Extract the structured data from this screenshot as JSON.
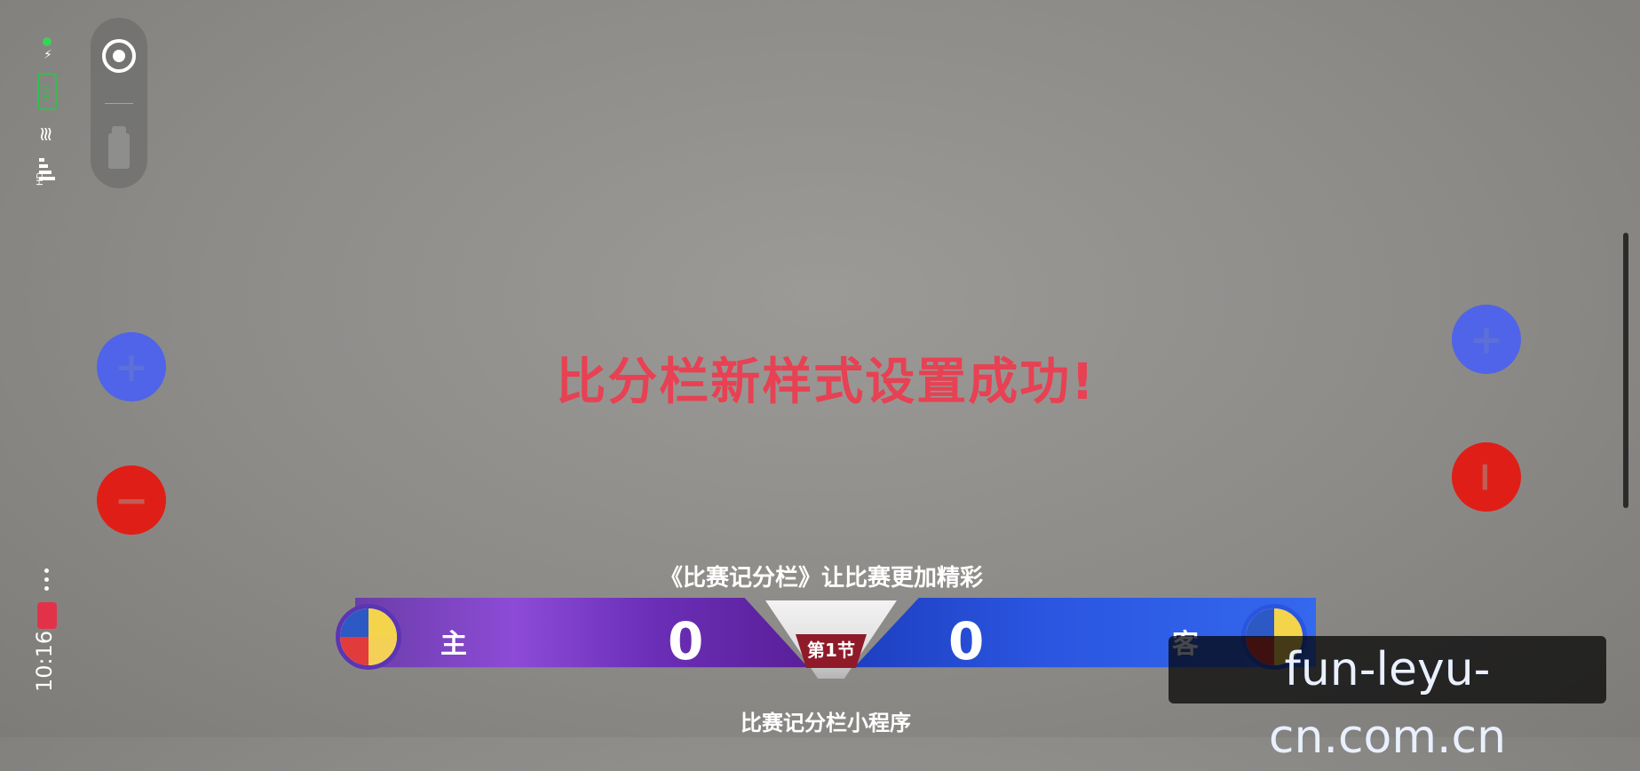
{
  "status_bar": {
    "battery": "100",
    "network": "HD",
    "time": "10:16"
  },
  "center_message": "比分栏新样式设置成功!",
  "slogan": "《比赛记分栏》让比赛更加精彩",
  "subtitle": "比赛记分栏小程序",
  "scoreboard": {
    "home": {
      "name": "主",
      "score": "0"
    },
    "away": {
      "name": "客",
      "score": "0"
    },
    "period": "第1节"
  },
  "controls": {
    "left_plus": "+",
    "left_minus": "−",
    "right_plus": "+",
    "right_minus": "−"
  },
  "watermark": "fun-leyu-cn.com.cn",
  "colors": {
    "accent_red": "#e74153",
    "home_purple": "#7d43c8",
    "away_blue": "#2a55e0",
    "plus_blue": "#4f64e8",
    "minus_red": "#df1f17"
  }
}
